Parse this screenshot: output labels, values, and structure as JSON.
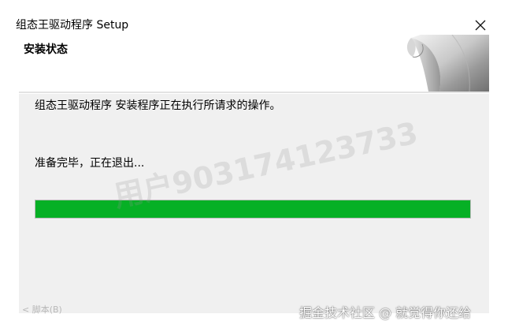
{
  "window": {
    "title": "组态王驱动程序 Setup",
    "close_icon": "close-icon"
  },
  "header": {
    "title": "安装状态"
  },
  "body": {
    "status": "组态王驱动程序 安装程序正在执行所请求的操作。",
    "detail": "准备完毕，正在退出...",
    "progress_percent": 100,
    "progress_color": "#06b025",
    "faint_text": "< 脚本(B)"
  },
  "overlay": {
    "watermark": "用户903174123733",
    "credit": "掘金技术社区 @ 就觉得你还给"
  }
}
